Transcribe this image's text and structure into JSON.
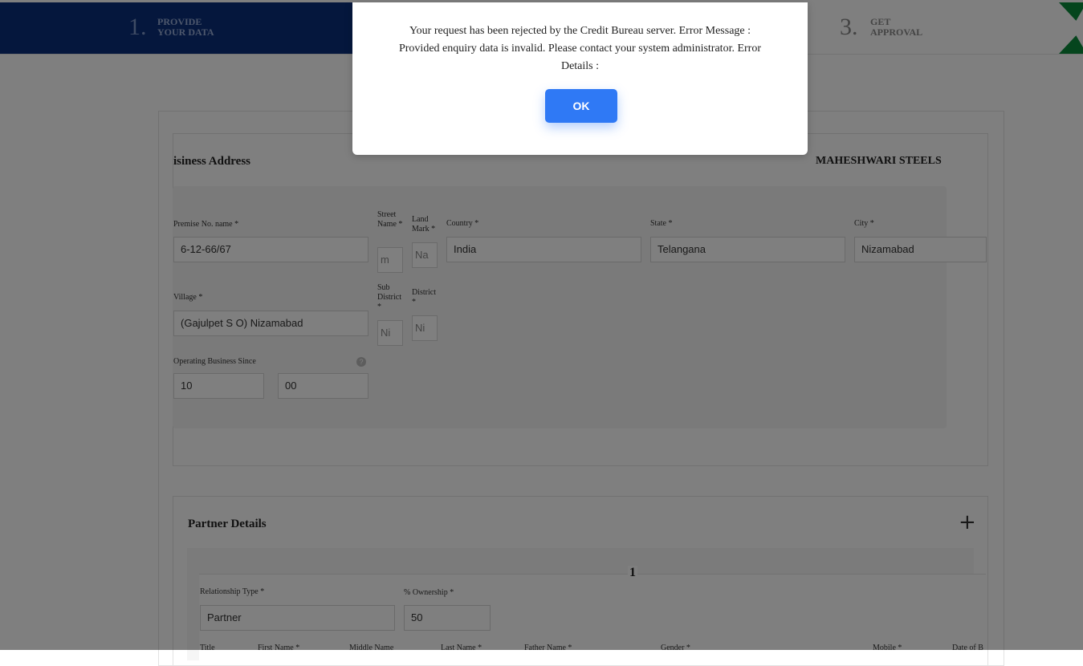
{
  "stepper": {
    "step1_num": "1.",
    "step1_label_line1": "PROVIDE",
    "step1_label_line2": "YOUR DATA",
    "step3_num": "3.",
    "step3_label_line1": "GET",
    "step3_label_line2": "APPROVAL",
    "active_color": "#0b2f7a",
    "accent_color": "#0a8a3a"
  },
  "business_address": {
    "title": "isiness Address",
    "company": "MAHESHWARI STEELS",
    "premise_label": "Premise No. name *",
    "premise_value": "6-12-66/67",
    "street_label": "Street Name *",
    "street_value": "m",
    "landmark_label": "Land Mark *",
    "landmark_value": "Na",
    "country_label": "Country *",
    "country_value": "India",
    "state_label": "State *",
    "state_value": "Telangana",
    "city_label": "City *",
    "city_value": "Nizamabad",
    "village_label": "Village *",
    "village_value": "(Gajulpet S O) Nizamabad",
    "subdistrict_label": "Sub District *",
    "subdistrict_value": "Ni",
    "district_label": "District *",
    "district_value": "Ni",
    "operating_label": "Operating Business Since",
    "operating_help": "?",
    "operating_years": "10",
    "operating_months": "00"
  },
  "partner": {
    "title": "Partner Details",
    "add_icon": "plus-icon",
    "index": "1",
    "relationship_label": "Relationship Type *",
    "relationship_value": "Partner",
    "ownership_label": "% Ownership *",
    "ownership_value": "50",
    "columns": [
      "Title",
      "First Name *",
      "Middle Name",
      "Last Name *",
      "Father Name *",
      "Gender *",
      "Mobile *",
      "Date of B"
    ]
  },
  "dialog": {
    "message": "Your request has been rejected by the Credit Bureau server. Error Message : Provided enquiry data is invalid. Please contact your system administrator. Error Details :",
    "ok_label": "OK",
    "button_color": "#2f79f5"
  }
}
